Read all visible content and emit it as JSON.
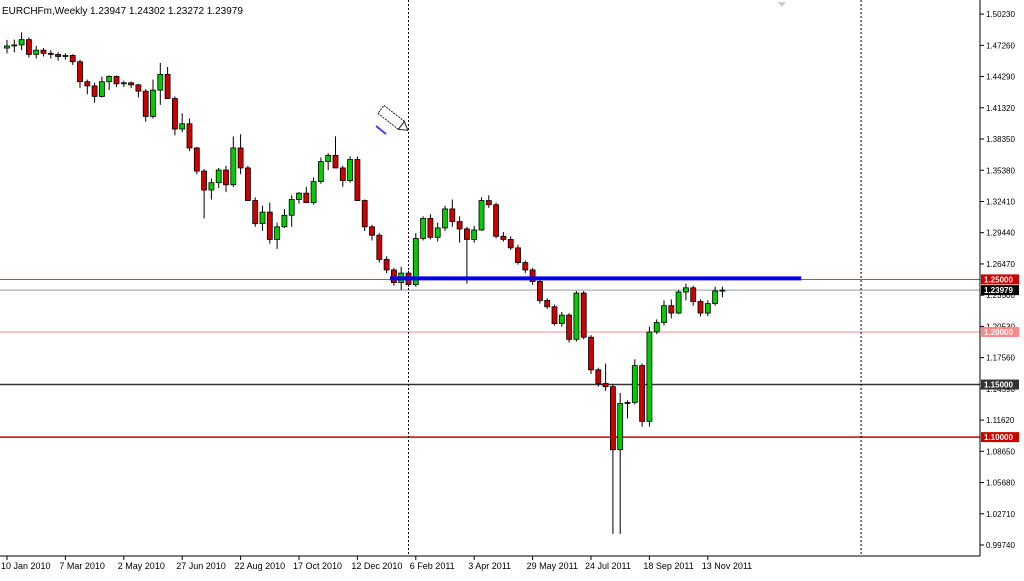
{
  "header": {
    "symbol": "EURCHFm,Weekly",
    "ohlc": "1.23947 1.24302 1.23272 1.23979"
  },
  "chart_data": {
    "type": "candlestick",
    "timeframe": "Weekly",
    "ylim": [
      0.9898,
      1.5062
    ],
    "grid": false,
    "colors": {
      "bull": "#00cc00",
      "bear": "#cc0000",
      "outline": "#000000",
      "trendline": "#0000ee",
      "level_red": "#cc0000",
      "level_dark": "#333333",
      "level_pink": "#ff8888",
      "bid_line": "#9999aa"
    },
    "y_ticks": [
      "1.50230",
      "1.47260",
      "1.44290",
      "1.41320",
      "1.38350",
      "1.35380",
      "1.32410",
      "1.29440",
      "1.26470",
      "1.23500",
      "1.20530",
      "1.17560",
      "1.14590",
      "1.11620",
      "1.08650",
      "1.05680",
      "1.02710",
      "0.99740"
    ],
    "x_labels": [
      "10 Jan 2010",
      "7 Mar 2010",
      "2 May 2010",
      "27 Jun 2010",
      "22 Aug 2010",
      "17 Oct 2010",
      "12 Dec 2010",
      "6 Feb 2011",
      "3 Apr 2011",
      "29 May 2011",
      "24 Jul 2011",
      "18 Sep 2011",
      "13 Nov 2011"
    ],
    "candles": [
      [
        1.47,
        1.4778,
        1.465,
        1.472
      ],
      [
        1.472,
        1.478,
        1.466,
        1.473
      ],
      [
        1.473,
        1.485,
        1.468,
        1.478
      ],
      [
        1.478,
        1.48,
        1.461,
        1.464
      ],
      [
        1.464,
        1.472,
        1.46,
        1.468
      ],
      [
        1.468,
        1.47,
        1.462,
        1.465
      ],
      [
        1.465,
        1.468,
        1.46,
        1.464
      ],
      [
        1.464,
        1.466,
        1.458,
        1.462
      ],
      [
        1.462,
        1.465,
        1.459,
        1.463
      ],
      [
        1.463,
        1.464,
        1.454,
        1.457
      ],
      [
        1.457,
        1.459,
        1.432,
        1.438
      ],
      [
        1.438,
        1.44,
        1.426,
        1.434
      ],
      [
        1.434,
        1.437,
        1.418,
        1.424
      ],
      [
        1.424,
        1.443,
        1.423,
        1.438
      ],
      [
        1.438,
        1.444,
        1.43,
        1.443
      ],
      [
        1.443,
        1.444,
        1.433,
        1.436
      ],
      [
        1.436,
        1.439,
        1.433,
        1.437
      ],
      [
        1.437,
        1.438,
        1.432,
        1.435
      ],
      [
        1.435,
        1.436,
        1.423,
        1.429
      ],
      [
        1.429,
        1.431,
        1.4,
        1.405
      ],
      [
        1.405,
        1.44,
        1.403,
        1.43
      ],
      [
        1.43,
        1.456,
        1.416,
        1.445
      ],
      [
        1.445,
        1.452,
        1.432,
        1.422
      ],
      [
        1.422,
        1.424,
        1.387,
        1.393
      ],
      [
        1.393,
        1.408,
        1.39,
        1.398
      ],
      [
        1.398,
        1.403,
        1.372,
        1.375
      ],
      [
        1.375,
        1.376,
        1.35,
        1.353
      ],
      [
        1.353,
        1.355,
        1.308,
        1.335
      ],
      [
        1.335,
        1.346,
        1.326,
        1.342
      ],
      [
        1.342,
        1.356,
        1.337,
        1.354
      ],
      [
        1.354,
        1.358,
        1.333,
        1.34
      ],
      [
        1.34,
        1.386,
        1.338,
        1.375
      ],
      [
        1.375,
        1.388,
        1.35,
        1.356
      ],
      [
        1.356,
        1.358,
        1.338,
        1.325
      ],
      [
        1.325,
        1.328,
        1.3,
        1.303
      ],
      [
        1.303,
        1.32,
        1.296,
        1.314
      ],
      [
        1.314,
        1.323,
        1.284,
        1.288
      ],
      [
        1.288,
        1.304,
        1.279,
        1.3
      ],
      [
        1.3,
        1.317,
        1.299,
        1.311
      ],
      [
        1.311,
        1.33,
        1.3,
        1.326
      ],
      [
        1.326,
        1.333,
        1.322,
        1.332
      ],
      [
        1.332,
        1.338,
        1.327,
        1.323
      ],
      [
        1.323,
        1.347,
        1.321,
        1.343
      ],
      [
        1.343,
        1.366,
        1.341,
        1.362
      ],
      [
        1.362,
        1.37,
        1.354,
        1.368
      ],
      [
        1.368,
        1.386,
        1.362,
        1.356
      ],
      [
        1.356,
        1.358,
        1.338,
        1.344
      ],
      [
        1.344,
        1.367,
        1.342,
        1.364
      ],
      [
        1.364,
        1.367,
        1.342,
        1.325
      ],
      [
        1.325,
        1.326,
        1.296,
        1.3
      ],
      [
        1.3,
        1.302,
        1.287,
        1.292
      ],
      [
        1.292,
        1.294,
        1.266,
        1.269
      ],
      [
        1.269,
        1.272,
        1.256,
        1.259
      ],
      [
        1.259,
        1.261,
        1.244,
        1.247
      ],
      [
        1.247,
        1.262,
        1.24,
        1.256
      ],
      [
        1.256,
        1.258,
        1.243,
        1.245
      ],
      [
        1.245,
        1.294,
        1.243,
        1.289
      ],
      [
        1.289,
        1.31,
        1.287,
        1.308
      ],
      [
        1.308,
        1.312,
        1.288,
        1.29
      ],
      [
        1.29,
        1.304,
        1.286,
        1.299
      ],
      [
        1.299,
        1.32,
        1.296,
        1.317
      ],
      [
        1.317,
        1.326,
        1.3,
        1.305
      ],
      [
        1.305,
        1.31,
        1.285,
        1.298
      ],
      [
        1.298,
        1.3,
        1.246,
        1.288
      ],
      [
        1.288,
        1.301,
        1.285,
        1.297
      ],
      [
        1.297,
        1.328,
        1.296,
        1.325
      ],
      [
        1.325,
        1.33,
        1.318,
        1.321
      ],
      [
        1.321,
        1.323,
        1.289,
        1.291
      ],
      [
        1.291,
        1.295,
        1.286,
        1.288
      ],
      [
        1.288,
        1.291,
        1.278,
        1.28
      ],
      [
        1.28,
        1.283,
        1.264,
        1.266
      ],
      [
        1.266,
        1.268,
        1.256,
        1.259
      ],
      [
        1.259,
        1.261,
        1.245,
        1.248
      ],
      [
        1.248,
        1.25,
        1.227,
        1.23
      ],
      [
        1.23,
        1.232,
        1.222,
        1.224
      ],
      [
        1.224,
        1.226,
        1.206,
        1.208
      ],
      [
        1.208,
        1.219,
        1.205,
        1.216
      ],
      [
        1.216,
        1.218,
        1.19,
        1.193
      ],
      [
        1.193,
        1.239,
        1.191,
        1.237
      ],
      [
        1.237,
        1.239,
        1.193,
        1.195
      ],
      [
        1.195,
        1.197,
        1.16,
        1.164
      ],
      [
        1.164,
        1.166,
        1.148,
        1.151
      ],
      [
        1.151,
        1.17,
        1.144,
        1.148
      ],
      [
        1.148,
        1.15,
        1.008,
        1.088
      ],
      [
        1.088,
        1.142,
        1.008,
        1.132
      ],
      [
        1.132,
        1.135,
        1.118,
        1.133
      ],
      [
        1.133,
        1.174,
        1.131,
        1.168
      ],
      [
        1.168,
        1.17,
        1.11,
        1.115
      ],
      [
        1.115,
        1.205,
        1.11,
        1.2
      ],
      [
        1.2,
        1.212,
        1.198,
        1.209
      ],
      [
        1.209,
        1.23,
        1.206,
        1.225
      ],
      [
        1.225,
        1.231,
        1.213,
        1.218
      ],
      [
        1.218,
        1.24,
        1.217,
        1.238
      ],
      [
        1.238,
        1.246,
        1.23,
        1.242
      ],
      [
        1.242,
        1.244,
        1.225,
        1.229
      ],
      [
        1.229,
        1.231,
        1.215,
        1.218
      ],
      [
        1.218,
        1.23,
        1.215,
        1.227
      ],
      [
        1.227,
        1.243,
        1.225,
        1.239
      ],
      [
        1.239,
        1.243,
        1.233,
        1.2398
      ]
    ],
    "bid_line": {
      "value": 1.23979,
      "label": "1.23979"
    },
    "levels": [
      {
        "value": 1.25,
        "label": "1.25000",
        "color": "#cc0000"
      },
      {
        "value": 1.2,
        "label": "1.20000",
        "color": "#ff8888"
      },
      {
        "value": 1.15,
        "label": "1.15000",
        "color": "#333333"
      },
      {
        "value": 1.1,
        "label": "1.10000",
        "color": "#cc0000"
      }
    ],
    "trendline": {
      "start_candle": 53,
      "end_candle": 104,
      "value": 1.251,
      "color": "#0000ee"
    },
    "period_separators": [
      55,
      117
    ]
  }
}
